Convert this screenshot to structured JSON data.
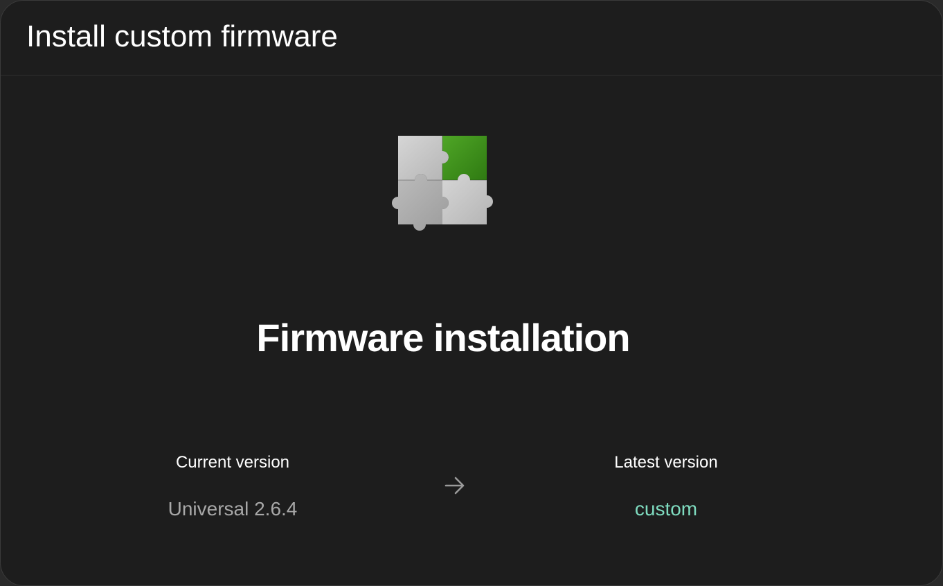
{
  "dialog": {
    "title": "Install custom firmware"
  },
  "illustration": {
    "icon": "puzzle-pieces-icon",
    "colors": {
      "green": "#3f8f1c",
      "light_grey": "#c8c8c8",
      "mid_grey": "#b0b0b0"
    }
  },
  "headline": "Firmware installation",
  "versions": {
    "current": {
      "label": "Current version",
      "value": "Universal 2.6.4"
    },
    "arrow_icon": "arrow-right-icon",
    "latest": {
      "label": "Latest version",
      "value": "custom",
      "color": "#7fdcc0"
    }
  }
}
